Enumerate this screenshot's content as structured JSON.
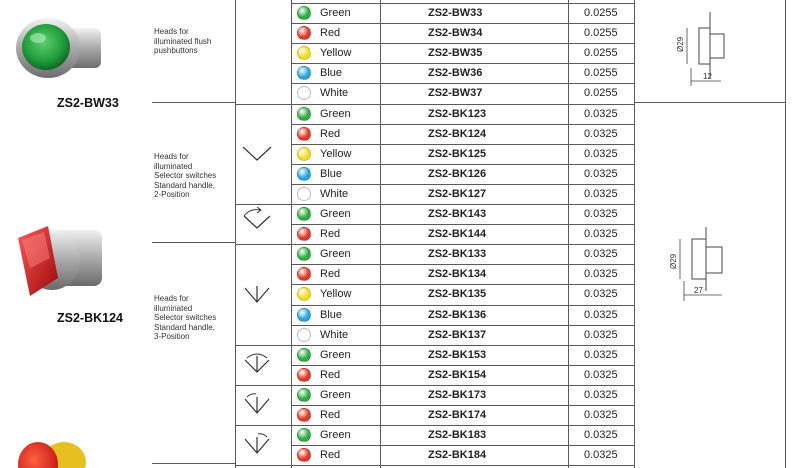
{
  "groups": [
    {
      "description": [
        "Heads for",
        "illuminated flush",
        "pushbuttons"
      ]
    },
    {
      "description": [
        "Heads for",
        "illuminated",
        "Selector switches",
        "Standard handle,",
        "2-Position"
      ]
    },
    {
      "description": [
        "Heads for",
        "illuminated",
        "Selector switches",
        "Standard handle,",
        "3-Position"
      ]
    }
  ],
  "product_labels": [
    "ZS2-BW33",
    "ZS2-BK124"
  ],
  "colors": {
    "Green": "#2fae3f",
    "Red": "#e23a28",
    "Yellow": "#f0dc22",
    "Blue": "#2aa4de",
    "White": "#ffffff"
  },
  "rows": [
    {
      "color": "Green",
      "model": "ZS2-BW33",
      "value": "0.0255"
    },
    {
      "color": "Red",
      "model": "ZS2-BW34",
      "value": "0.0255"
    },
    {
      "color": "Yellow",
      "model": "ZS2-BW35",
      "value": "0.0255"
    },
    {
      "color": "Blue",
      "model": "ZS2-BW36",
      "value": "0.0255"
    },
    {
      "color": "White",
      "model": "ZS2-BW37",
      "value": "0.0255"
    },
    {
      "color": "Green",
      "model": "ZS2-BK123",
      "value": "0.0325"
    },
    {
      "color": "Red",
      "model": "ZS2-BK124",
      "value": "0.0325"
    },
    {
      "color": "Yellow",
      "model": "ZS2-BK125",
      "value": "0.0325"
    },
    {
      "color": "Blue",
      "model": "ZS2-BK126",
      "value": "0.0325"
    },
    {
      "color": "White",
      "model": "ZS2-BK127",
      "value": "0.0325"
    },
    {
      "color": "Green",
      "model": "ZS2-BK143",
      "value": "0.0325"
    },
    {
      "color": "Red",
      "model": "ZS2-BK144",
      "value": "0.0325"
    },
    {
      "color": "Green",
      "model": "ZS2-BK133",
      "value": "0.0325"
    },
    {
      "color": "Red",
      "model": "ZS2-BK134",
      "value": "0.0325"
    },
    {
      "color": "Yellow",
      "model": "ZS2-BK135",
      "value": "0.0325"
    },
    {
      "color": "Blue",
      "model": "ZS2-BK136",
      "value": "0.0325"
    },
    {
      "color": "White",
      "model": "ZS2-BK137",
      "value": "0.0325"
    },
    {
      "color": "Green",
      "model": "ZS2-BK153",
      "value": "0.0325"
    },
    {
      "color": "Red",
      "model": "ZS2-BK154",
      "value": "0.0325"
    },
    {
      "color": "Green",
      "model": "ZS2-BK173",
      "value": "0.0325"
    },
    {
      "color": "Red",
      "model": "ZS2-BK174",
      "value": "0.0325"
    },
    {
      "color": "Green",
      "model": "ZS2-BK183",
      "value": "0.0325"
    },
    {
      "color": "Red",
      "model": "ZS2-BK184",
      "value": "0.0325"
    }
  ],
  "dimensions": {
    "pushbutton": {
      "diameter": "Ø29",
      "depth": "12"
    },
    "selector": {
      "diameter": "Ø29",
      "depth": "27"
    }
  }
}
